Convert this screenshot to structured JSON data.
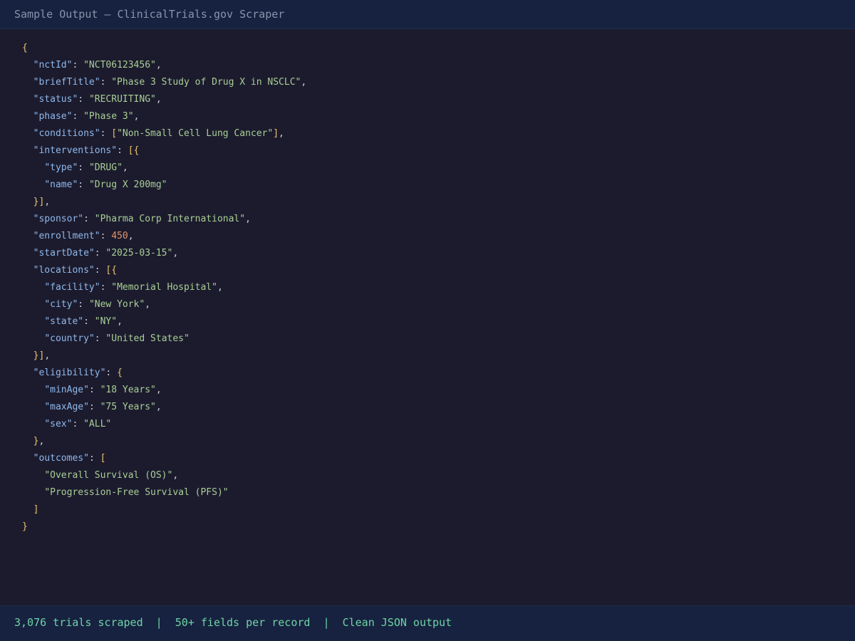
{
  "window": {
    "title": "Sample Output — ClinicalTrials.gov Scraper"
  },
  "json_lines": [
    {
      "indent": 0,
      "tokens": [
        {
          "t": "b",
          "v": "{"
        }
      ]
    },
    {
      "indent": 1,
      "tokens": [
        {
          "t": "k",
          "v": "\"nctId\""
        },
        {
          "t": "p",
          "v": ": "
        },
        {
          "t": "s",
          "v": "\"NCT06123456\""
        },
        {
          "t": "p",
          "v": ","
        }
      ]
    },
    {
      "indent": 1,
      "tokens": [
        {
          "t": "k",
          "v": "\"briefTitle\""
        },
        {
          "t": "p",
          "v": ": "
        },
        {
          "t": "s",
          "v": "\"Phase 3 Study of Drug X in NSCLC\""
        },
        {
          "t": "p",
          "v": ","
        }
      ]
    },
    {
      "indent": 1,
      "tokens": [
        {
          "t": "k",
          "v": "\"status\""
        },
        {
          "t": "p",
          "v": ": "
        },
        {
          "t": "s",
          "v": "\"RECRUITING\""
        },
        {
          "t": "p",
          "v": ","
        }
      ]
    },
    {
      "indent": 1,
      "tokens": [
        {
          "t": "k",
          "v": "\"phase\""
        },
        {
          "t": "p",
          "v": ": "
        },
        {
          "t": "s",
          "v": "\"Phase 3\""
        },
        {
          "t": "p",
          "v": ","
        }
      ]
    },
    {
      "indent": 1,
      "tokens": [
        {
          "t": "k",
          "v": "\"conditions\""
        },
        {
          "t": "p",
          "v": ": "
        },
        {
          "t": "b",
          "v": "["
        },
        {
          "t": "s",
          "v": "\"Non-Small Cell Lung Cancer\""
        },
        {
          "t": "b",
          "v": "]"
        },
        {
          "t": "p",
          "v": ","
        }
      ]
    },
    {
      "indent": 1,
      "tokens": [
        {
          "t": "k",
          "v": "\"interventions\""
        },
        {
          "t": "p",
          "v": ": "
        },
        {
          "t": "b",
          "v": "[{"
        }
      ]
    },
    {
      "indent": 2,
      "tokens": [
        {
          "t": "k",
          "v": "\"type\""
        },
        {
          "t": "p",
          "v": ": "
        },
        {
          "t": "s",
          "v": "\"DRUG\""
        },
        {
          "t": "p",
          "v": ","
        }
      ]
    },
    {
      "indent": 2,
      "tokens": [
        {
          "t": "k",
          "v": "\"name\""
        },
        {
          "t": "p",
          "v": ": "
        },
        {
          "t": "s",
          "v": "\"Drug X 200mg\""
        }
      ]
    },
    {
      "indent": 1,
      "tokens": [
        {
          "t": "b",
          "v": "}]"
        },
        {
          "t": "p",
          "v": ","
        }
      ]
    },
    {
      "indent": 1,
      "tokens": [
        {
          "t": "k",
          "v": "\"sponsor\""
        },
        {
          "t": "p",
          "v": ": "
        },
        {
          "t": "s",
          "v": "\"Pharma Corp International\""
        },
        {
          "t": "p",
          "v": ","
        }
      ]
    },
    {
      "indent": 1,
      "tokens": [
        {
          "t": "k",
          "v": "\"enrollment\""
        },
        {
          "t": "p",
          "v": ": "
        },
        {
          "t": "n",
          "v": "450"
        },
        {
          "t": "p",
          "v": ","
        }
      ]
    },
    {
      "indent": 1,
      "tokens": [
        {
          "t": "k",
          "v": "\"startDate\""
        },
        {
          "t": "p",
          "v": ": "
        },
        {
          "t": "s",
          "v": "\"2025-03-15\""
        },
        {
          "t": "p",
          "v": ","
        }
      ]
    },
    {
      "indent": 1,
      "tokens": [
        {
          "t": "k",
          "v": "\"locations\""
        },
        {
          "t": "p",
          "v": ": "
        },
        {
          "t": "b",
          "v": "[{"
        }
      ]
    },
    {
      "indent": 2,
      "tokens": [
        {
          "t": "k",
          "v": "\"facility\""
        },
        {
          "t": "p",
          "v": ": "
        },
        {
          "t": "s",
          "v": "\"Memorial Hospital\""
        },
        {
          "t": "p",
          "v": ","
        }
      ]
    },
    {
      "indent": 2,
      "tokens": [
        {
          "t": "k",
          "v": "\"city\""
        },
        {
          "t": "p",
          "v": ": "
        },
        {
          "t": "s",
          "v": "\"New York\""
        },
        {
          "t": "p",
          "v": ","
        }
      ]
    },
    {
      "indent": 2,
      "tokens": [
        {
          "t": "k",
          "v": "\"state\""
        },
        {
          "t": "p",
          "v": ": "
        },
        {
          "t": "s",
          "v": "\"NY\""
        },
        {
          "t": "p",
          "v": ","
        }
      ]
    },
    {
      "indent": 2,
      "tokens": [
        {
          "t": "k",
          "v": "\"country\""
        },
        {
          "t": "p",
          "v": ": "
        },
        {
          "t": "s",
          "v": "\"United States\""
        }
      ]
    },
    {
      "indent": 1,
      "tokens": [
        {
          "t": "b",
          "v": "}]"
        },
        {
          "t": "p",
          "v": ","
        }
      ]
    },
    {
      "indent": 1,
      "tokens": [
        {
          "t": "k",
          "v": "\"eligibility\""
        },
        {
          "t": "p",
          "v": ": "
        },
        {
          "t": "b",
          "v": "{"
        }
      ]
    },
    {
      "indent": 2,
      "tokens": [
        {
          "t": "k",
          "v": "\"minAge\""
        },
        {
          "t": "p",
          "v": ": "
        },
        {
          "t": "s",
          "v": "\"18 Years\""
        },
        {
          "t": "p",
          "v": ","
        }
      ]
    },
    {
      "indent": 2,
      "tokens": [
        {
          "t": "k",
          "v": "\"maxAge\""
        },
        {
          "t": "p",
          "v": ": "
        },
        {
          "t": "s",
          "v": "\"75 Years\""
        },
        {
          "t": "p",
          "v": ","
        }
      ]
    },
    {
      "indent": 2,
      "tokens": [
        {
          "t": "k",
          "v": "\"sex\""
        },
        {
          "t": "p",
          "v": ": "
        },
        {
          "t": "s",
          "v": "\"ALL\""
        }
      ]
    },
    {
      "indent": 1,
      "tokens": [
        {
          "t": "b",
          "v": "}"
        },
        {
          "t": "p",
          "v": ","
        }
      ]
    },
    {
      "indent": 1,
      "tokens": [
        {
          "t": "k",
          "v": "\"outcomes\""
        },
        {
          "t": "p",
          "v": ": "
        },
        {
          "t": "b",
          "v": "["
        }
      ]
    },
    {
      "indent": 2,
      "tokens": [
        {
          "t": "s",
          "v": "\"Overall Survival (OS)\""
        },
        {
          "t": "p",
          "v": ","
        }
      ]
    },
    {
      "indent": 2,
      "tokens": [
        {
          "t": "s",
          "v": "\"Progression-Free Survival (PFS)\""
        }
      ]
    },
    {
      "indent": 1,
      "tokens": [
        {
          "t": "b",
          "v": "]"
        }
      ]
    },
    {
      "indent": 0,
      "tokens": [
        {
          "t": "b",
          "v": "}"
        }
      ]
    }
  ],
  "footer": {
    "stats": "3,076 trials scraped  |  50+ fields per record  |  Clean JSON output"
  },
  "colors": {
    "background": "#1c1b2e",
    "header_bg": "#172240",
    "key": "#8fb8ea",
    "string": "#a9cf94",
    "number": "#e39566",
    "bracket": "#e9c46a",
    "footer_text": "#6fd3a5"
  }
}
